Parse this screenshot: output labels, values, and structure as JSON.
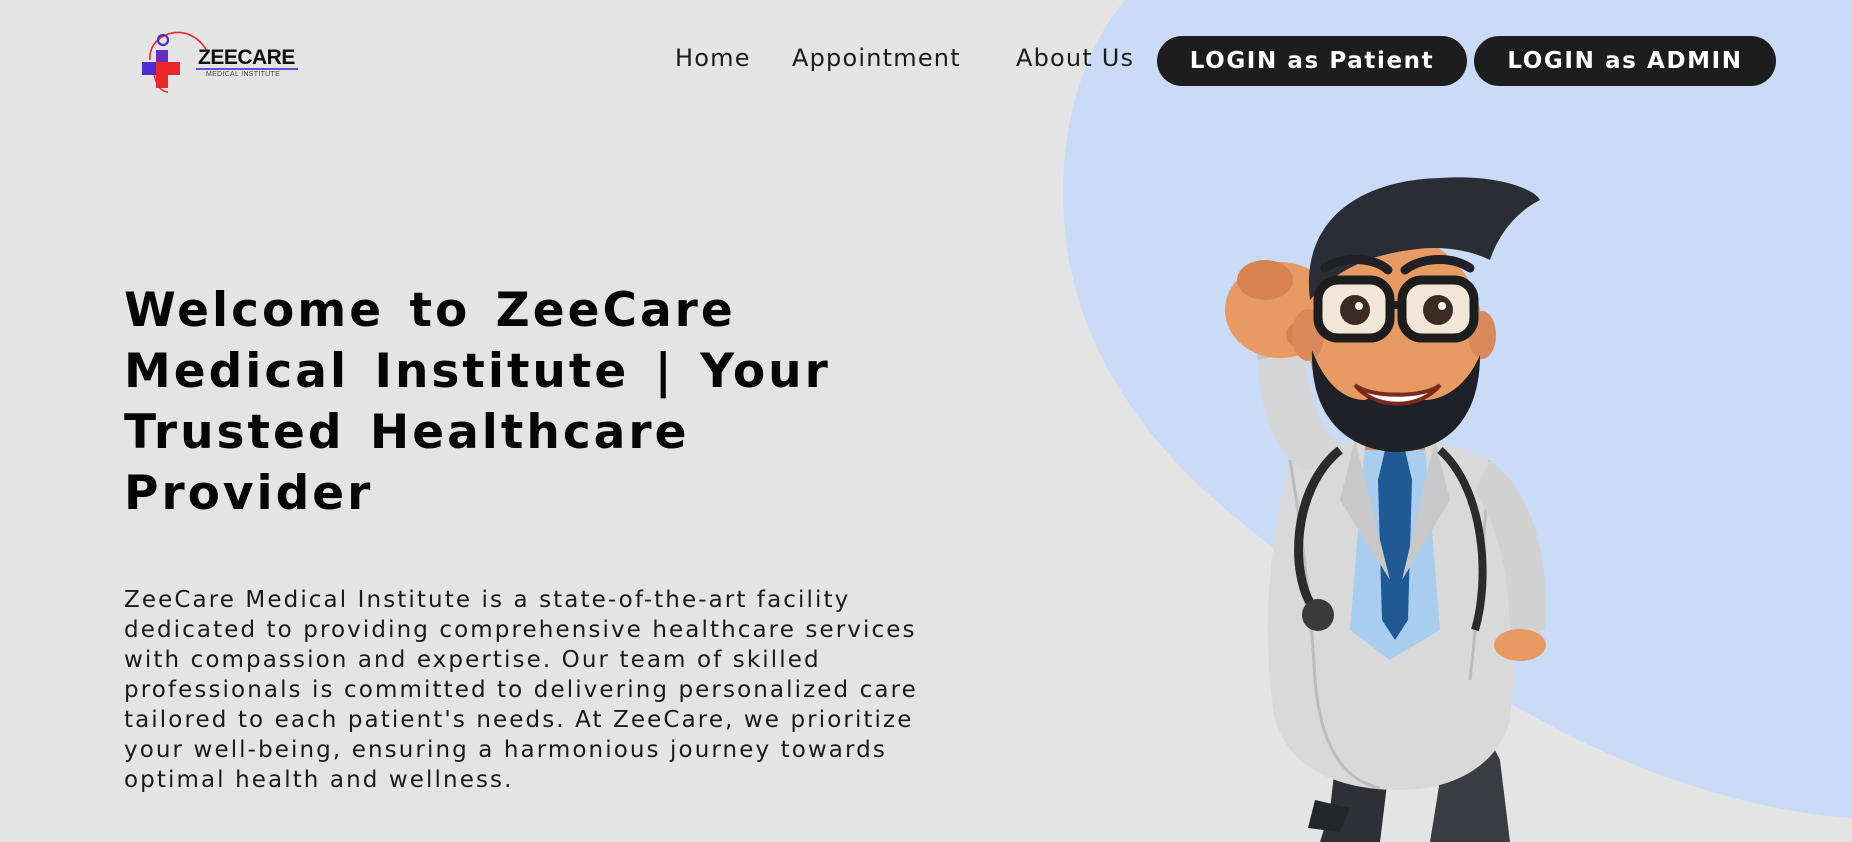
{
  "brand": {
    "name": "ZEECARE",
    "tagline": "MEDICAL INSTITUTE",
    "colors": {
      "cross_red": "#e8262b",
      "accent_purple": "#4f2bd6",
      "background": "#e4e4e4",
      "blob_blue": "#c9dbf7",
      "button_dark": "#1d1d1d"
    }
  },
  "nav": {
    "home": "Home",
    "appointment": "Appointment",
    "about": "About Us",
    "login_patient": "LOGIN as Patient",
    "login_admin": "LOGIN as ADMIN"
  },
  "hero": {
    "title": "Welcome to ZeeCare Medical Institute | Your Trusted Healthcare Provider",
    "description": "ZeeCare Medical Institute is a state-of-the-art facility dedicated to providing comprehensive healthcare services with compassion and expertise. Our team of skilled professionals is committed to delivering personalized care tailored to each patient's needs. At ZeeCare, we prioritize your well-being, ensuring a harmonious journey towards optimal health and wellness.",
    "illustration": "cartoon-doctor-superhero-pose"
  },
  "icons": [
    "medical-cross-logo-icon"
  ]
}
